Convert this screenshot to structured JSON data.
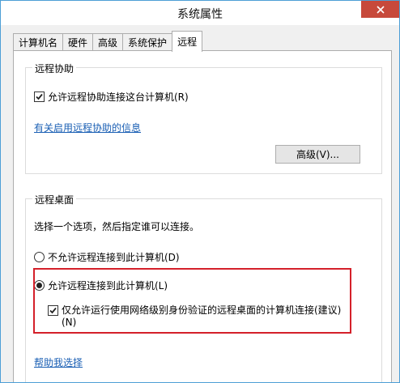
{
  "window": {
    "title": "系统属性"
  },
  "tabs": [
    {
      "label": "计算机名"
    },
    {
      "label": "硬件"
    },
    {
      "label": "高级"
    },
    {
      "label": "系统保护"
    },
    {
      "label": "远程",
      "active": true
    }
  ],
  "remote_assistance": {
    "title": "远程协助",
    "allow_label": "允许远程协助连接这台计算机(R)",
    "allow_checked": true,
    "info_link": "有关启用远程协助的信息",
    "advanced_button": "高级(V)..."
  },
  "remote_desktop": {
    "title": "远程桌面",
    "instruction": "选择一个选项，然后指定谁可以连接。",
    "option_deny": "不允许远程连接到此计算机(D)",
    "option_allow": "允许远程连接到此计算机(L)",
    "selected": "allow",
    "nla_label_line1": "仅允许运行使用网络级别身份验证的远程桌面的计算机连接(建议)",
    "nla_label_line2": "(N)",
    "nla_checked": true,
    "help_link": "帮助我选择"
  },
  "colors": {
    "highlight": "#d4202a",
    "link": "#1a5fb4",
    "close_button": "#c7493b"
  }
}
